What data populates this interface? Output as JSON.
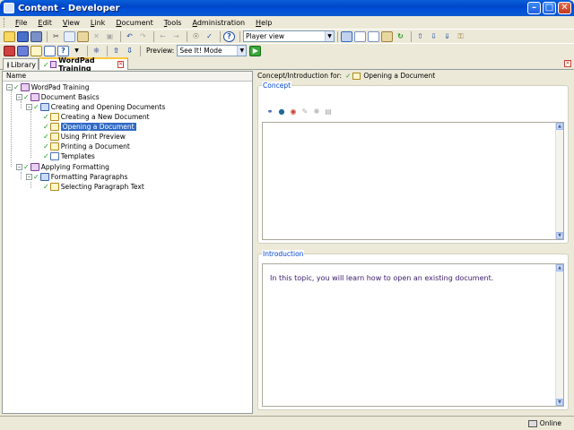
{
  "window": {
    "title": "Content - Developer"
  },
  "menu": [
    "File",
    "Edit",
    "View",
    "Link",
    "Document",
    "Tools",
    "Administration",
    "Help"
  ],
  "toolbar": {
    "view_combo": "Player view",
    "preview_label": "Preview:",
    "preview_mode": "See It! Mode"
  },
  "tabs": {
    "library": "Library",
    "active": "WordPad Training"
  },
  "tree": {
    "column": "Name",
    "nodes": [
      {
        "label": "WordPad Training",
        "icon": "module-icon"
      },
      {
        "label": "Document Basics",
        "icon": "module-icon"
      },
      {
        "label": "Creating and Opening Documents",
        "icon": "section-icon"
      },
      {
        "label": "Creating a New Document",
        "icon": "topic-icon"
      },
      {
        "label": "Opening a Document",
        "icon": "topic-icon"
      },
      {
        "label": "Using Print Preview",
        "icon": "topic-icon"
      },
      {
        "label": "Printing a Document",
        "icon": "topic-icon"
      },
      {
        "label": "Templates",
        "icon": "document-icon"
      },
      {
        "label": "Applying Formatting",
        "icon": "module-icon"
      },
      {
        "label": "Formatting Paragraphs",
        "icon": "section-icon"
      },
      {
        "label": "Selecting Paragraph Text",
        "icon": "topic-icon"
      }
    ]
  },
  "right": {
    "crumb_label": "Concept/Introduction for:",
    "crumb_item": "Opening a Document",
    "concept_title": "Concept",
    "intro_title": "Introduction",
    "intro_text": "In this topic, you will learn how to open an existing document."
  },
  "status": {
    "text": "Online"
  },
  "colors": {
    "titlebar": "#0046c8",
    "selection": "#316ac5",
    "check": "#1a9a1a",
    "group_title": "#0046d5"
  }
}
